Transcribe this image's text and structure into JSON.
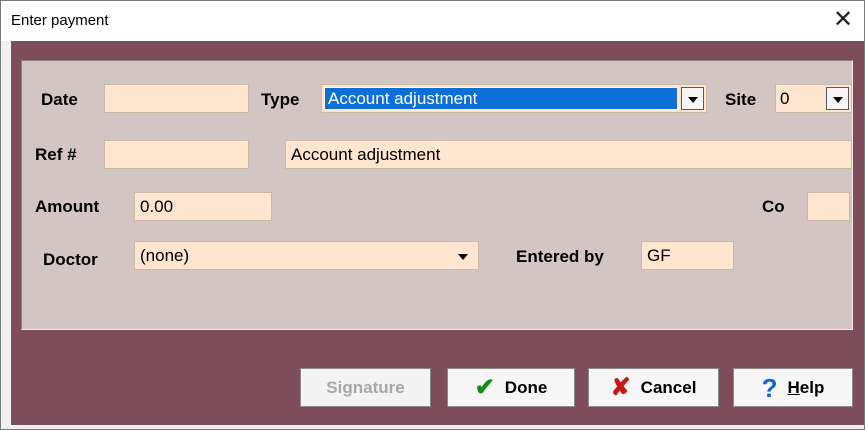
{
  "window": {
    "title": "Enter payment",
    "close_glyph": "✕"
  },
  "form": {
    "date_label": "Date",
    "date_value": "",
    "type_label": "Type",
    "type_value": "Account adjustment",
    "site_label": "Site",
    "site_value": "0",
    "ref_label": "Ref #",
    "ref_value": "",
    "description_value": "Account adjustment",
    "amount_label": "Amount",
    "amount_value": "0.00",
    "co_label": "Co",
    "co_value": "",
    "doctor_label": "Doctor",
    "doctor_value": "(none)",
    "entered_by_label": "Entered by",
    "entered_by_value": "GF"
  },
  "buttons": {
    "signature": "Signature",
    "done": "Done",
    "cancel": "Cancel",
    "help": "Help"
  },
  "icons": {
    "done": "checkmark-icon",
    "cancel": "x-icon",
    "help": "question-icon"
  },
  "colors": {
    "dialog_bg": "#7e4d5c",
    "panel_bg": "#d4c5c5",
    "field_bg": "#fde5cf",
    "selection": "#0f6fd8"
  }
}
